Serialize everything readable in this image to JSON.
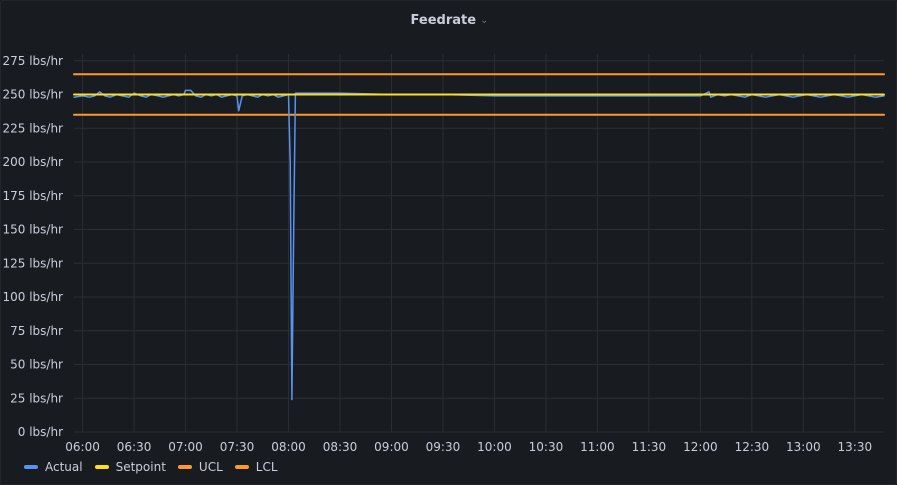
{
  "panel": {
    "title": "Feedrate"
  },
  "colors": {
    "Actual": "#5794f2",
    "Setpoint": "#fade2a",
    "UCL": "#ff9830",
    "LCL": "#ff9830",
    "grid": "#2c2e33",
    "text": "#ccccdc"
  },
  "chart_data": {
    "type": "line",
    "title": "Feedrate",
    "y_unit": "lbs/hr",
    "ylim": [
      0,
      280
    ],
    "y_ticks": [
      0,
      25,
      50,
      75,
      100,
      125,
      150,
      175,
      200,
      225,
      250,
      275
    ],
    "y_tick_labels": [
      "0 lbs/hr",
      "25 lbs/hr",
      "50 lbs/hr",
      "75 lbs/hr",
      "100 lbs/hr",
      "125 lbs/hr",
      "150 lbs/hr",
      "175 lbs/hr",
      "200 lbs/hr",
      "225 lbs/hr",
      "250 lbs/hr",
      "275 lbs/hr"
    ],
    "xlim": [
      "05:55",
      "13:47"
    ],
    "x_tick_labels": [
      "06:00",
      "06:30",
      "07:00",
      "07:30",
      "08:00",
      "08:30",
      "09:00",
      "09:30",
      "10:00",
      "10:30",
      "11:00",
      "11:30",
      "12:00",
      "12:30",
      "13:00",
      "13:30"
    ],
    "grid": true,
    "legend_position": "bottom-left",
    "series": [
      {
        "name": "Actual",
        "x": [
          "05:55",
          "06:00",
          "06:04",
          "06:07",
          "06:10",
          "06:13",
          "06:16",
          "06:20",
          "06:23",
          "06:27",
          "06:30",
          "06:34",
          "06:37",
          "06:40",
          "06:44",
          "06:47",
          "06:50",
          "06:53",
          "06:56",
          "06:59",
          "07:00",
          "07:03",
          "07:06",
          "07:09",
          "07:12",
          "07:15",
          "07:18",
          "07:21",
          "07:24",
          "07:27",
          "07:30",
          "07:31",
          "07:33",
          "07:36",
          "07:39",
          "07:42",
          "07:45",
          "07:48",
          "07:51",
          "07:54",
          "07:57",
          "08:00",
          "08:01",
          "08:02",
          "08:03",
          "08:04",
          "08:05",
          "08:06",
          "08:10",
          "08:30",
          "09:00",
          "09:30",
          "10:00",
          "10:30",
          "11:00",
          "11:30",
          "12:00",
          "12:05",
          "12:06",
          "12:08",
          "12:10",
          "12:14",
          "12:18",
          "12:22",
          "12:26",
          "12:30",
          "12:34",
          "12:38",
          "12:42",
          "12:46",
          "12:50",
          "12:54",
          "12:58",
          "13:02",
          "13:06",
          "13:10",
          "13:14",
          "13:18",
          "13:22",
          "13:26",
          "13:30",
          "13:34",
          "13:38",
          "13:42",
          "13:47"
        ],
        "y": [
          248,
          249,
          248,
          249,
          252,
          249,
          248,
          250,
          249,
          248,
          251,
          249,
          248,
          250,
          249,
          248,
          249,
          250,
          249,
          250,
          253,
          253,
          249,
          248,
          250,
          249,
          250,
          248,
          249,
          250,
          249,
          238,
          249,
          250,
          249,
          248,
          250,
          249,
          250,
          248,
          249,
          250,
          200,
          24,
          150,
          251,
          251,
          251,
          251,
          251,
          250,
          250,
          249,
          249,
          249,
          249,
          249,
          252,
          248,
          249,
          250,
          249,
          250,
          249,
          248,
          250,
          249,
          248,
          249,
          250,
          249,
          248,
          249,
          250,
          249,
          248,
          249,
          250,
          249,
          248,
          249,
          250,
          249,
          248,
          249
        ]
      },
      {
        "name": "Setpoint",
        "x": [
          "05:55",
          "13:47"
        ],
        "y": [
          250,
          250
        ]
      },
      {
        "name": "UCL",
        "x": [
          "05:55",
          "13:47"
        ],
        "y": [
          265,
          265
        ]
      },
      {
        "name": "LCL",
        "x": [
          "05:55",
          "13:47"
        ],
        "y": [
          235,
          235
        ]
      }
    ]
  }
}
